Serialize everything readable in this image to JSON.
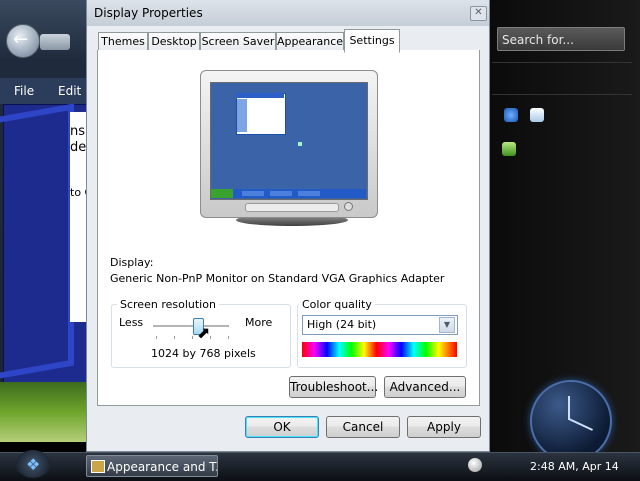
{
  "background_window": {
    "menu": [
      "File",
      "Edit"
    ],
    "text_fragments": [
      "ns",
      "de",
      "to C"
    ]
  },
  "sidebar": {
    "search_placeholder": "Search for..."
  },
  "taskbar": {
    "task_button": "Appearance and T...",
    "clock": "2:48 AM, Apr 14"
  },
  "dialog": {
    "title": "Display Properties",
    "close_glyph": "✕",
    "tabs": [
      "Themes",
      "Desktop",
      "Screen Saver",
      "Appearance",
      "Settings"
    ],
    "active_tab": "Settings",
    "display_label": "Display:",
    "display_value": "Generic Non-PnP Monitor on Standard VGA Graphics Adapter",
    "screen_resolution": {
      "legend": "Screen resolution",
      "less": "Less",
      "more": "More",
      "value": "1024 by 768 pixels"
    },
    "color_quality": {
      "legend": "Color quality",
      "selected": "High (24 bit)"
    },
    "buttons": {
      "troubleshoot": "Troubleshoot...",
      "advanced": "Advanced...",
      "ok": "OK",
      "cancel": "Cancel",
      "apply": "Apply"
    }
  },
  "colors": {
    "desktop_blue": "#3a63a8",
    "accent_blue": "#3c7fb1"
  }
}
